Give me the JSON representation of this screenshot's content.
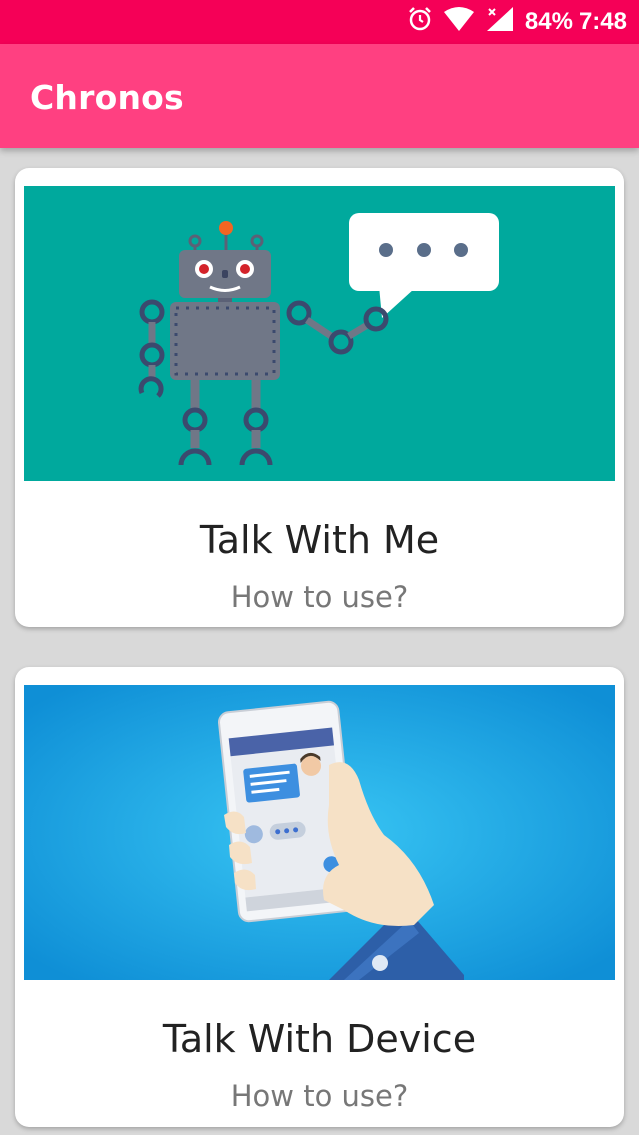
{
  "status_bar": {
    "battery": "84%",
    "time": "7:48",
    "icons": [
      "alarm-icon",
      "wifi-icon",
      "signal-icon"
    ]
  },
  "app_bar": {
    "title": "Chronos"
  },
  "cards": [
    {
      "title": "Talk With Me",
      "subtitle": "How to use?",
      "image": "robot-illustration"
    },
    {
      "title": "Talk With Device",
      "subtitle": "How to use?",
      "image": "phone-in-hand-illustration"
    }
  ],
  "colors": {
    "status_bar": "#f50057",
    "app_bar": "#ff4081",
    "card1_bg": "#00a99d",
    "card2_bg": "#1a9fe0"
  }
}
